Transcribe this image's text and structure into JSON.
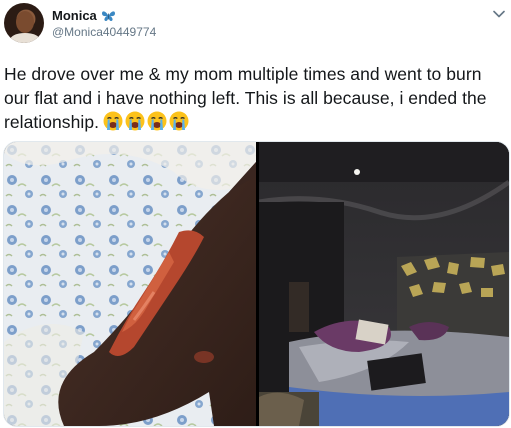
{
  "tweet": {
    "display_name": "Monica",
    "name_emoji": "butterfly-icon",
    "handle": "@Monica40449774",
    "text": "He drove over me & my mom multiple times and went to burn our flat and i have nothing left. This is all because, i ended the relationship.",
    "emojis": [
      "sob-icon",
      "sob-icon",
      "sob-icon",
      "sob-icon"
    ],
    "menu_icon": "chevron-down-icon"
  },
  "media": {
    "left_image": "burned-arm-photo",
    "right_image": "burned-bedroom-photo"
  },
  "colors": {
    "text": "#14171a",
    "secondary_text": "#657786",
    "butterfly": "#3b88c3",
    "border": "#e1e8ed"
  }
}
